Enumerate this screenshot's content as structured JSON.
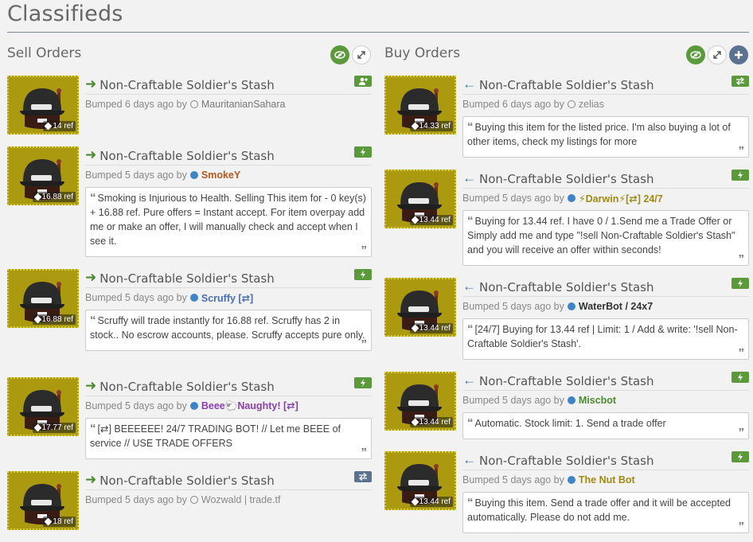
{
  "page": {
    "title": "Classifieds"
  },
  "sell": {
    "title": "Sell Orders",
    "listings": [
      {
        "name": "Non-Craftable Soldier's Stash",
        "bumped": "Bumped 6 days ago by",
        "user": "MauritanianSahara",
        "user_color": "#777777",
        "user_bold": false,
        "dot": "hollow",
        "price": "14 ref",
        "badge": "user-plus-icon",
        "comment": ""
      },
      {
        "name": "Non-Craftable Soldier's Stash",
        "bumped": "Bumped 5 days ago by",
        "user": "SmokeY",
        "user_color": "#b05a20",
        "user_bold": true,
        "dot": "blue",
        "price": "16.88 ref",
        "badge": "lightning-icon",
        "comment": "Smoking is Injurious to Health. Selling This item for - 0 key(s) + 16.88 ref. Pure offers = Instant accept. For item overpay add me or make an offer, I will manually check and accept when I see it."
      },
      {
        "name": "Non-Craftable Soldier's Stash",
        "bumped": "Bumped 5 days ago by",
        "user": "Scruffy [⇄]",
        "user_color": "#4a6fb0",
        "user_bold": true,
        "dot": "blue",
        "price": "16.88 ref",
        "badge": "lightning-icon",
        "comment": "Scruffy will trade instantly for 16.88 ref. Scruffy has 2 in stock.. No escrow accounts, please. Scruffy accepts pure only."
      },
      {
        "name": "Non-Craftable Soldier's Stash",
        "bumped": "Bumped 5 days ago by",
        "user": "Beee🐑Naughty! [⇄]",
        "user_color": "#8a3fb0",
        "user_bold": true,
        "dot": "blue",
        "price": "17.77 ref",
        "badge": "lightning-icon",
        "comment": "[⇄] BEEEEEE! 24/7 TRADING BOT! // Let me BEEE of service // USE TRADE OFFERS"
      },
      {
        "name": "Non-Craftable Soldier's Stash",
        "bumped": "Bumped 5 days ago by",
        "user": "Wozwald | trade.tf",
        "user_color": "#888888",
        "user_bold": false,
        "dot": "hollow",
        "price": "18 ref",
        "badge": "swap-icon",
        "comment": ""
      }
    ]
  },
  "buy": {
    "title": "Buy Orders",
    "listings": [
      {
        "name": "Non-Craftable Soldier's Stash",
        "bumped": "Bumped 6 days ago by",
        "user": "zelias",
        "user_color": "#888888",
        "user_bold": false,
        "dot": "hollow",
        "price": "14.33 ref",
        "badge": "swap-icon",
        "comment": "Buying this item for the listed price. I'm also buying a lot of other items, check my listings for more"
      },
      {
        "name": "Non-Craftable Soldier's Stash",
        "bumped": "Bumped 5 days ago by",
        "user": "⚡Darwin⚡[⇄] 24/7",
        "user_color": "#a08a10",
        "user_bold": true,
        "dot": "blue",
        "price": "13.44 ref",
        "badge": "lightning-icon",
        "comment": "Buying for 13.44 ref. I have 0 / 1.Send me a Trade Offer or Simply add me and type \"!sell Non-Craftable Soldier's Stash\" and you will receive an offer within seconds!"
      },
      {
        "name": "Non-Craftable Soldier's Stash",
        "bumped": "Bumped 5 days ago by",
        "user": "WaterBot / 24x7",
        "user_color": "#333333",
        "user_bold": true,
        "dot": "blue",
        "price": "13.44 ref",
        "badge": "lightning-icon",
        "comment": "[24/7] Buying for 13.44 ref | Limit: 1 / Add & write: '!sell Non-Craftable Soldier's Stash'."
      },
      {
        "name": "Non-Craftable Soldier's Stash",
        "bumped": "Bumped 5 days ago by",
        "user": "Miscbot",
        "user_color": "#4b8a2e",
        "user_bold": true,
        "dot": "blue",
        "price": "13.44 ref",
        "badge": "lightning-icon",
        "comment": "Automatic. Stock limit: 1. Send a trade offer"
      },
      {
        "name": "Non-Craftable Soldier's Stash",
        "bumped": "Bumped 5 days ago by",
        "user": "The Nut Bot",
        "user_color": "#a08a10",
        "user_bold": true,
        "dot": "blue",
        "price": "13.44 ref",
        "badge": "lightning-icon",
        "comment": "Buying this item. Send a trade offer and it will be accepted automatically. Please do not add me."
      }
    ]
  }
}
